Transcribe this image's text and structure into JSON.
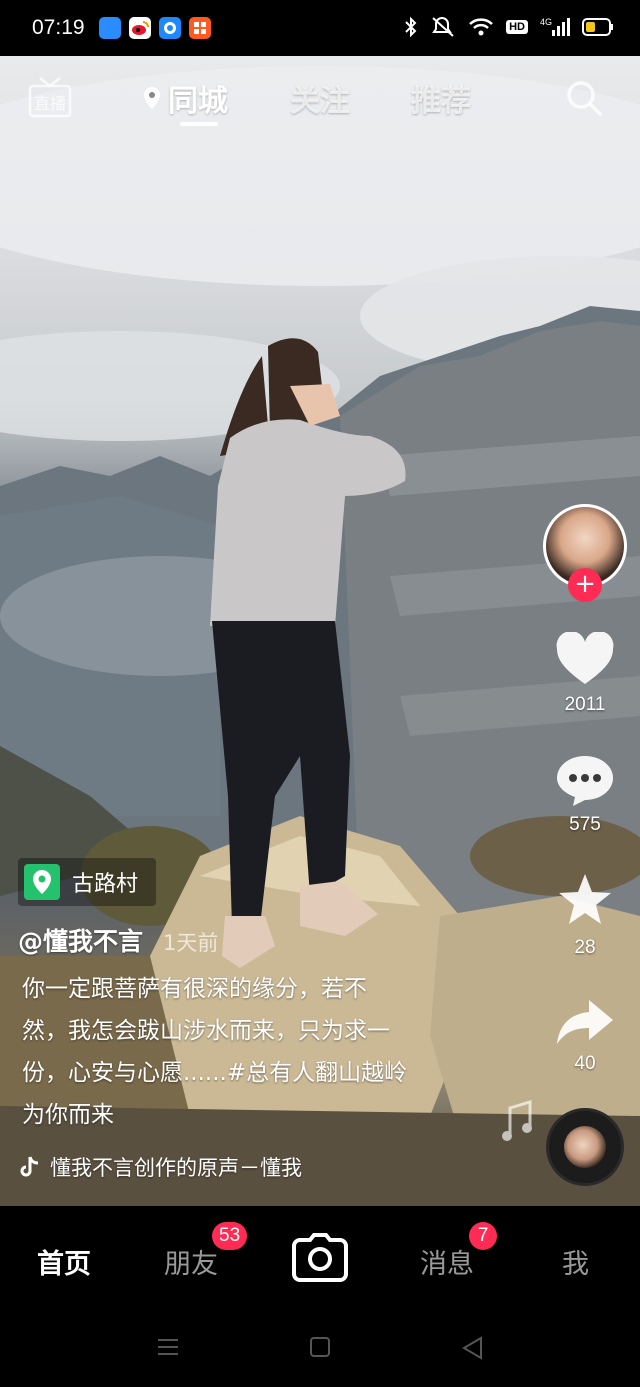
{
  "status_bar": {
    "time": "07:19",
    "network": "4G",
    "hd": "HD",
    "notification_icons": [
      "app-icon-blue",
      "weibo-icon",
      "browser-icon",
      "orange-app-icon"
    ],
    "colors": {
      "notif1": "#2b8cff",
      "notif2": "#ff7a00",
      "notif3": "#1e88ff",
      "notif4": "#ff5a1f"
    }
  },
  "top_nav": {
    "live_label": "直播",
    "tabs": [
      {
        "label": "同城",
        "active": true
      },
      {
        "label": "关注",
        "active": false
      },
      {
        "label": "推荐",
        "active": false
      }
    ]
  },
  "video": {
    "location": "古路村",
    "author": "@懂我不言",
    "time_ago": "1天前",
    "caption_lines": [
      "你一定跟菩萨有很深的缘分，若不",
      "然，我怎会跋山涉水而来，只为求一",
      "份，心安与心愿......#总有人翻山越岭",
      "为你而来"
    ],
    "music": "懂我不言创作的原声－懂我"
  },
  "actions": {
    "likes": "2011",
    "comments": "575",
    "favorites": "28",
    "shares": "40"
  },
  "tab_bar": {
    "home": "首页",
    "friends": "朋友",
    "friends_badge": "53",
    "messages": "消息",
    "messages_badge": "7",
    "me": "我"
  },
  "colors": {
    "accent": "#fe2c55",
    "location_green": "#25c26e"
  }
}
